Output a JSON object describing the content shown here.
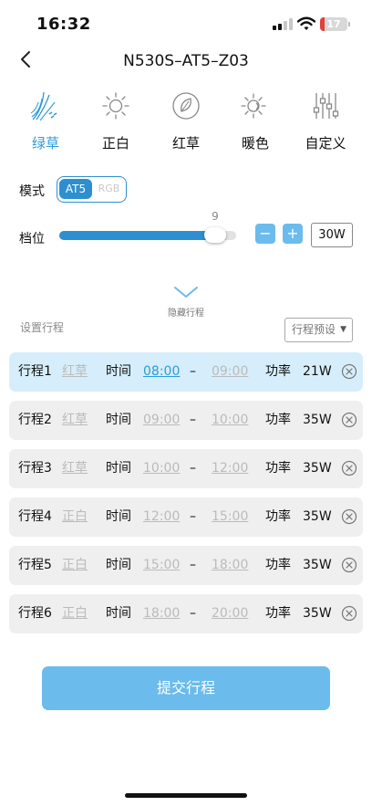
{
  "status_bar": {
    "time": "16:32",
    "battery": "17",
    "battery_level": 0.17,
    "battery_color": "#e0423a"
  },
  "header": {
    "title": "N530S–AT5–Z03",
    "back_icon": "chevron-left-icon"
  },
  "modes": [
    {
      "label": "绿草",
      "icon": "grass-icon",
      "active": true
    },
    {
      "label": "正白",
      "icon": "sun-icon",
      "active": false
    },
    {
      "label": "红草",
      "icon": "leaf-icon",
      "active": false
    },
    {
      "label": "暖色",
      "icon": "warm-sun-icon",
      "active": false
    },
    {
      "label": "自定义",
      "icon": "sliders-icon",
      "active": false
    }
  ],
  "mode_row": {
    "label": "模式",
    "options": [
      "AT5",
      "RGB"
    ],
    "selected": "AT5"
  },
  "level_row": {
    "label": "档位",
    "value": "9",
    "level_fraction": 0.88,
    "minus_label": "−",
    "plus_label": "+",
    "power": "30W"
  },
  "collapse": {
    "label": "隐藏行程",
    "icon": "chevron-down-icon"
  },
  "schedule_section": {
    "label": "设置行程",
    "preset_label": "行程预设",
    "preset_caret": "▼"
  },
  "schedules": [
    {
      "name": "行程1",
      "mode": "红草",
      "time_label": "时间",
      "start": "08:00",
      "dash": "–",
      "end": "09:00",
      "power_label": "功率",
      "power": "21W",
      "active": true
    },
    {
      "name": "行程2",
      "mode": "红草",
      "time_label": "时间",
      "start": "09:00",
      "dash": "–",
      "end": "10:00",
      "power_label": "功率",
      "power": "35W",
      "active": false
    },
    {
      "name": "行程3",
      "mode": "红草",
      "time_label": "时间",
      "start": "10:00",
      "dash": "–",
      "end": "12:00",
      "power_label": "功率",
      "power": "35W",
      "active": false
    },
    {
      "name": "行程4",
      "mode": "正白",
      "time_label": "时间",
      "start": "12:00",
      "dash": "–",
      "end": "15:00",
      "power_label": "功率",
      "power": "35W",
      "active": false
    },
    {
      "name": "行程5",
      "mode": "正白",
      "time_label": "时间",
      "start": "15:00",
      "dash": "–",
      "end": "18:00",
      "power_label": "功率",
      "power": "35W",
      "active": false
    },
    {
      "name": "行程6",
      "mode": "正白",
      "time_label": "时间",
      "start": "18:00",
      "dash": "–",
      "end": "20:00",
      "power_label": "功率",
      "power": "35W",
      "active": false
    }
  ],
  "submit": {
    "label": "提交行程"
  },
  "colors": {
    "accent": "#2e8fd0",
    "accent_light": "#6bbbed",
    "active_row": "#d6eefb",
    "row_bg": "#efefef"
  }
}
